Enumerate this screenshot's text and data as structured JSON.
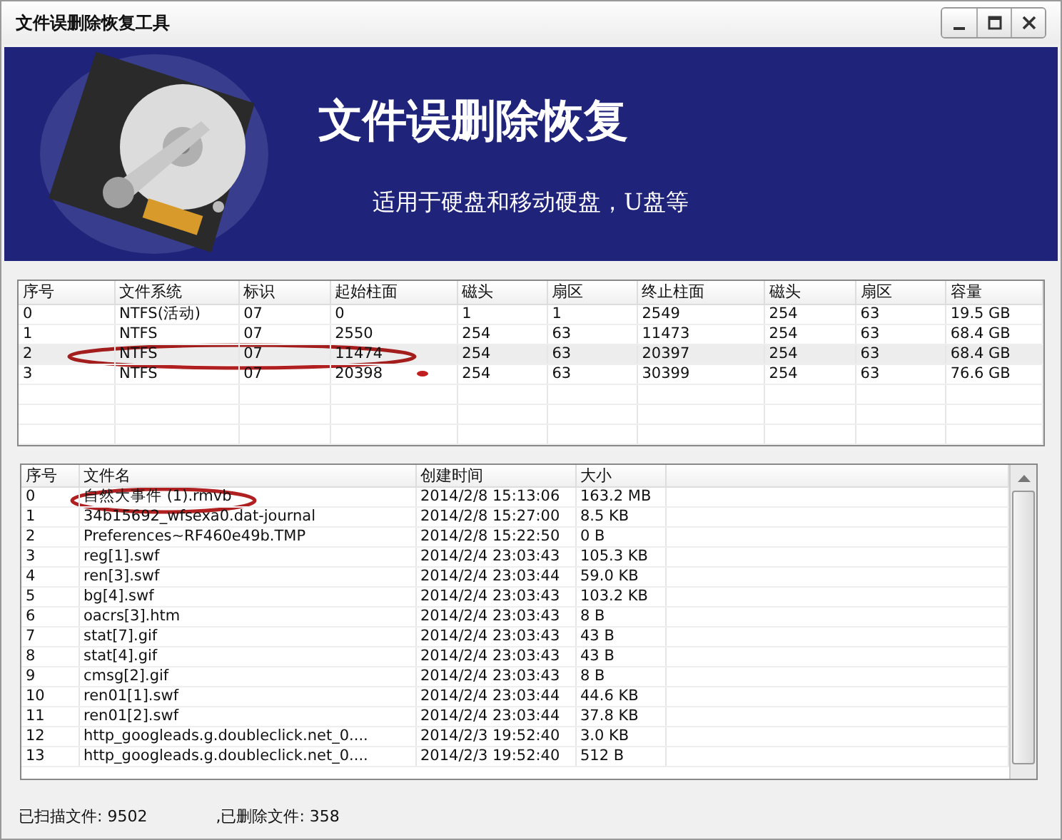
{
  "window": {
    "title": "文件误删除恢复工具"
  },
  "banner": {
    "title": "文件误删除恢复",
    "subtitle": "适用于硬盘和移动硬盘，U盘等"
  },
  "partitions": {
    "columns": [
      "序号",
      "文件系统",
      "标识",
      "起始柱面",
      "磁头",
      "扇区",
      "终止柱面",
      "磁头",
      "扇区",
      "容量"
    ],
    "rows": [
      {
        "cells": [
          "0",
          "NTFS(活动)",
          "07",
          "0",
          "1",
          "1",
          "2549",
          "254",
          "63",
          "19.5 GB"
        ],
        "selected": false
      },
      {
        "cells": [
          "1",
          "NTFS",
          "07",
          "2550",
          "254",
          "63",
          "11473",
          "254",
          "63",
          "68.4 GB"
        ],
        "selected": false
      },
      {
        "cells": [
          "2",
          "NTFS",
          "07",
          "11474",
          "254",
          "63",
          "20397",
          "254",
          "63",
          "68.4 GB"
        ],
        "selected": true
      },
      {
        "cells": [
          "3",
          "NTFS",
          "07",
          "20398",
          "254",
          "63",
          "30399",
          "254",
          "63",
          "76.6 GB"
        ],
        "selected": false
      }
    ]
  },
  "files": {
    "columns": [
      "序号",
      "文件名",
      "创建时间",
      "大小"
    ],
    "rows": [
      [
        "0",
        "自然大事件 (1).rmvb",
        "2014/2/8 15:13:06",
        "163.2 MB"
      ],
      [
        "1",
        "34b15692_wfsexa0.dat-journal",
        "2014/2/8 15:27:00",
        "8.5 KB"
      ],
      [
        "2",
        "Preferences~RF460e49b.TMP",
        "2014/2/8 15:22:50",
        "0 B"
      ],
      [
        "3",
        "reg[1].swf",
        "2014/2/4 23:03:43",
        "105.3 KB"
      ],
      [
        "4",
        "ren[3].swf",
        "2014/2/4 23:03:44",
        "59.0 KB"
      ],
      [
        "5",
        "bg[4].swf",
        "2014/2/4 23:03:43",
        "103.2 KB"
      ],
      [
        "6",
        "oacrs[3].htm",
        "2014/2/4 23:03:43",
        "8 B"
      ],
      [
        "7",
        "stat[7].gif",
        "2014/2/4 23:03:43",
        "43 B"
      ],
      [
        "8",
        "stat[4].gif",
        "2014/2/4 23:03:43",
        "43 B"
      ],
      [
        "9",
        "cmsg[2].gif",
        "2014/2/4 23:03:43",
        "8 B"
      ],
      [
        "10",
        "ren01[1].swf",
        "2014/2/4 23:03:44",
        "44.6 KB"
      ],
      [
        "11",
        "ren01[2].swf",
        "2014/2/4 23:03:44",
        "37.8 KB"
      ],
      [
        "12",
        "http_googleads.g.doubleclick.net_0....",
        "2014/2/3 19:52:40",
        "3.0 KB"
      ],
      [
        "13",
        "http_googleads.g.doubleclick.net_0....",
        "2014/2/3 19:52:40",
        "512 B"
      ]
    ]
  },
  "status": {
    "scanned": "已扫描文件: 9502",
    "deleted": ",已删除文件:  358"
  }
}
